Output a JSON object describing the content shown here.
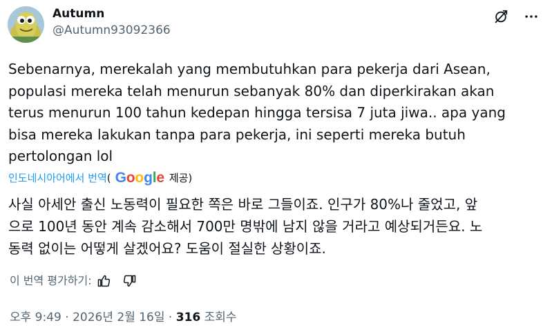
{
  "author": {
    "display_name": "Autumn",
    "handle": "@Autumn93092366"
  },
  "icons": {
    "grok": "grok-slash-icon",
    "more": "more-horizontal-icon",
    "like": "thumbs-up-icon",
    "dislike": "thumbs-down-icon"
  },
  "tweet": {
    "text_lines": [
      "Sebenarnya, merekalah yang membutuhkan para pekerja dari Asean,",
      "populasi mereka telah menurun sebanyak 80% dan diperkirakan akan",
      "terus menurun 100 tahun kedepan hingga tersisa 7 juta jiwa.. apa yang",
      "bisa mereka lakukan tanpa para pekerja, ini seperti mereka butuh",
      "pertolongan lol"
    ]
  },
  "translation": {
    "translated_from": "인도네시아어에서 번역",
    "open_paren": "(",
    "provider": "Google",
    "provided_by": "제공)",
    "text_lines": [
      "사실 아세안 출신 노동력이 필요한 쪽은 바로 그들이죠. 인구가 80%나 줄었고, 앞",
      "으로 100년 동안 계속 감소해서 700만 명밖에 남지 않을 거라고 예상되거든요. 노",
      "동력 없이는 어떻게 살겠어요? 도움이 절실한 상황이죠."
    ],
    "rate_label": "이 번역 평가하기:"
  },
  "meta": {
    "time": "오후 9:49",
    "separator": " · ",
    "date": "2026년 2월 16일",
    "views_count": "316",
    "views_label": " 조회수"
  },
  "colors": {
    "link": "#1d9bf0",
    "secondary_text": "#536471",
    "primary_text": "#0f1419",
    "google_blue": "#4285F4",
    "google_red": "#EA4335",
    "google_yellow": "#FBBC05",
    "google_green": "#34A853"
  }
}
